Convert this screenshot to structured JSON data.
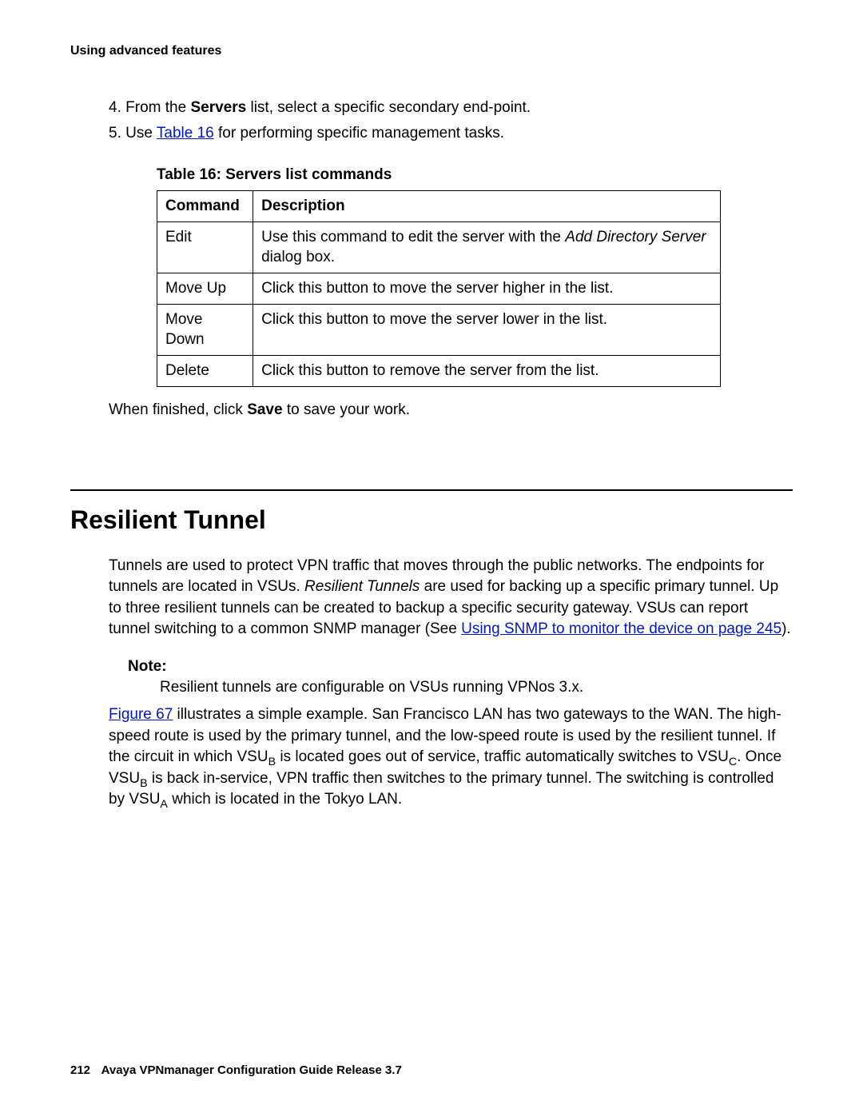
{
  "header": "Using advanced features",
  "steps": {
    "s4_num": "4.",
    "s4_a": "From the ",
    "s4_bold": "Servers",
    "s4_b": " list, select a specific secondary end-point.",
    "s5_num": "5.",
    "s5_a": "Use ",
    "s5_link": "Table 16",
    "s5_b": " for performing specific management tasks."
  },
  "table": {
    "caption": "Table 16: Servers list commands",
    "h_cmd": "Command",
    "h_desc": "Description",
    "r1_cmd": "Edit",
    "r1_a": "Use this command to edit the server with the ",
    "r1_i": "Add Directory Server",
    "r1_b": " dialog box.",
    "r2_cmd": "Move Up",
    "r2_desc": "Click this button to move the server higher in the list.",
    "r3_cmd": "Move Down",
    "r3_desc": "Click this button to move the server lower in the list.",
    "r4_cmd": "Delete",
    "r4_desc": "Click this button to remove the server from the list."
  },
  "after_table": {
    "a": "When finished, click ",
    "bold": "Save",
    "b": " to save your work."
  },
  "section_title": "Resilient Tunnel",
  "p1": {
    "a": "Tunnels are used to protect VPN traffic that moves through the public networks. The endpoints for tunnels are located in VSUs. ",
    "i": "Resilient Tunnels",
    "b": " are used for backing up a specific primary tunnel. Up to three resilient tunnels can be created to backup a specific security gateway. VSUs can report tunnel switching to a common SNMP manager (See ",
    "link": "Using SNMP to monitor the device",
    "link2_pre": " on page ",
    "link2": "245",
    "c": ")."
  },
  "note": {
    "label": "Note:",
    "text": "Resilient tunnels are configurable on VSUs running VPNos 3.x."
  },
  "p2": {
    "link": "Figure 67",
    "a": " illustrates a simple example. San Francisco LAN has two gateways to the WAN. The high-speed route is used by the primary tunnel, and the low-speed route is used by the resilient tunnel. If the circuit in which VSU",
    "sub_b": "B",
    "b": " is located goes out of service, traffic automatically switches to VSU",
    "sub_c": "C",
    "c": ". Once VSU",
    "sub_b2": "B",
    "d": " is back in-service, VPN traffic then switches to the primary tunnel. The switching is controlled by VSU",
    "sub_a": "A",
    "e": " which is located in the Tokyo LAN."
  },
  "footer": {
    "page": "212",
    "title": "Avaya VPNmanager Configuration Guide Release 3.7"
  }
}
